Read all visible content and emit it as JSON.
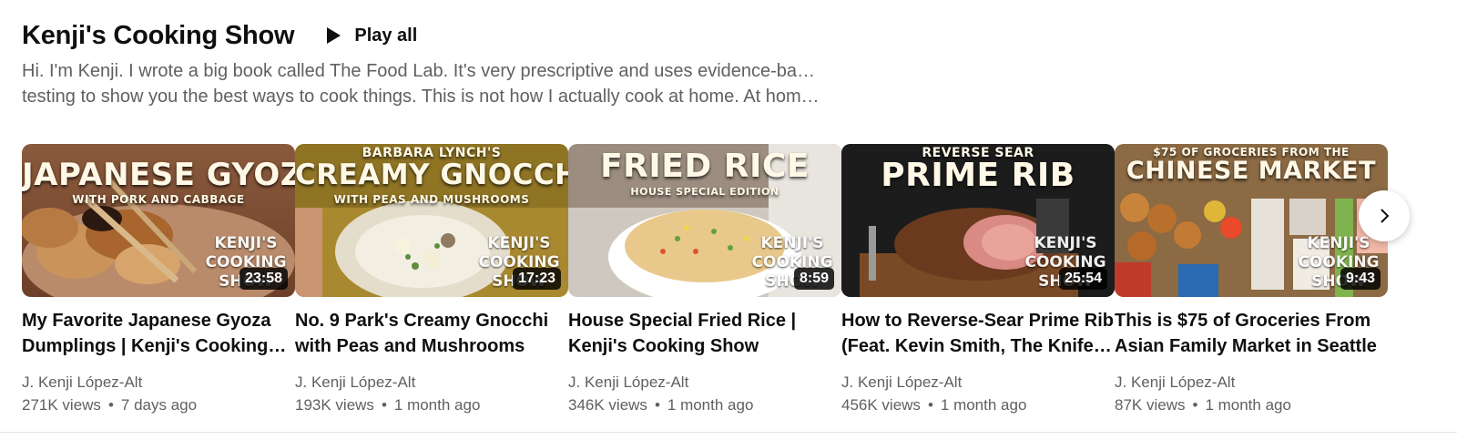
{
  "shelf": {
    "title": "Kenji's Cooking Show",
    "play_all_label": "Play all",
    "description_line1": "Hi. I'm Kenji. I wrote a big book called The Food Lab. It's very prescriptive and uses evidence-based",
    "description_line2": "testing to show you the best ways to cook things. This is not how I actually cook at home. At hom…",
    "icons": {
      "play": "play-icon",
      "next": "chevron-right-icon"
    }
  },
  "videos": [
    {
      "title": "My Favorite Japanese Gyoza Dumplings | Kenji's Cooking Show",
      "channel": "J. Kenji López-Alt",
      "views": "271K views",
      "age": "7 days ago",
      "duration": "23:58",
      "thumb_caption": "JAPANESE GYOZA",
      "thumb_subcaption": "WITH PORK AND CABBAGE",
      "thumb_brand": "KENJI'S COOKING SHOW"
    },
    {
      "title": "No. 9 Park's Creamy Gnocchi with Peas and Mushrooms",
      "channel": "J. Kenji López-Alt",
      "views": "193K views",
      "age": "1 month ago",
      "duration": "17:23",
      "thumb_precaption": "BARBARA LYNCH'S",
      "thumb_caption": "CREAMY GNOCCHI",
      "thumb_subcaption": "WITH PEAS AND MUSHROOMS",
      "thumb_brand": "KENJI'S COOKING SHOW"
    },
    {
      "title": "House Special Fried Rice | Kenji's Cooking Show",
      "channel": "J. Kenji López-Alt",
      "views": "346K views",
      "age": "1 month ago",
      "duration": "8:59",
      "thumb_caption": "FRIED RICE",
      "thumb_subcaption": "HOUSE SPECIAL EDITION",
      "thumb_brand": "KENJI'S COOKING SHOW"
    },
    {
      "title": "How to Reverse-Sear Prime Rib (Feat. Kevin Smith, The Knife Guy)",
      "channel": "J. Kenji López-Alt",
      "views": "456K views",
      "age": "1 month ago",
      "duration": "25:54",
      "thumb_precaption": "REVERSE SEAR",
      "thumb_caption": "PRIME RIB",
      "thumb_brand": "KENJI'S COOKING SHOW"
    },
    {
      "title": "This is $75 of Groceries From Asian Family Market in Seattle",
      "channel": "J. Kenji López-Alt",
      "views": "87K views",
      "age": "1 month ago",
      "duration": "9:43",
      "thumb_precaption": "$75 OF GROCERIES FROM THE",
      "thumb_caption": "CHINESE MARKET",
      "thumb_brand": "KENJI'S COOKING SHOW"
    }
  ],
  "colors": {
    "text_primary": "#0f0f0f",
    "text_secondary": "#606060",
    "duration_badge": "#000000cc",
    "caption": "#fff8e6"
  }
}
